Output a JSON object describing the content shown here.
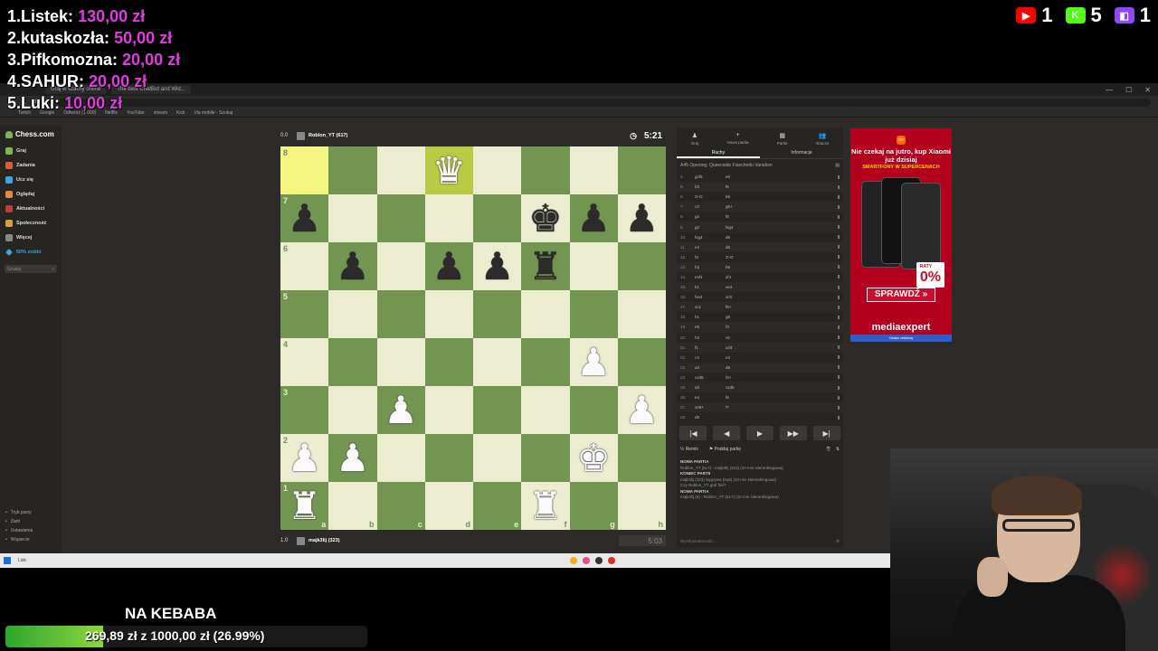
{
  "donations": [
    {
      "rank": "1.",
      "name": "Listek:",
      "amount": "130,00 zł"
    },
    {
      "rank": "2.",
      "name": "kutaskozła:",
      "amount": "50,00 zł"
    },
    {
      "rank": "3.",
      "name": "Pifkomozna:",
      "amount": "20,00 zł"
    },
    {
      "rank": "4.",
      "name": "SAHUR:",
      "amount": "20,00 zł"
    },
    {
      "rank": "5.",
      "name": "Luki:",
      "amount": "10,00 zł"
    }
  ],
  "counters": [
    {
      "platform": "youtube",
      "count": "1",
      "color": "#ff0000",
      "icon": "youtube-icon"
    },
    {
      "platform": "kick",
      "count": "5",
      "color": "#53fc18",
      "icon": "kick-icon"
    },
    {
      "platform": "twitch",
      "count": "1",
      "color": "#9146ff",
      "icon": "twitch-icon"
    }
  ],
  "browser": {
    "tabs": [
      "Graj w szachy online",
      "The best ChatBot and Wid..."
    ],
    "bookmarks": [
      "Twitch",
      "Google",
      "Odtwórz (1 000)",
      "Netflix",
      "YouTube",
      "stream",
      "Kick",
      "Via mobile - Szukaj"
    ]
  },
  "sidebar": {
    "logo": "Chess.com",
    "items": [
      {
        "label": "Graj",
        "color": "#81b64c"
      },
      {
        "label": "Zadania",
        "color": "#e05a3a"
      },
      {
        "label": "Ucz się",
        "color": "#3ba4d9"
      },
      {
        "label": "Oglądaj",
        "color": "#e08b3a"
      },
      {
        "label": "Aktualności",
        "color": "#c23b3b"
      },
      {
        "label": "Społeczność",
        "color": "#d9a03a"
      },
      {
        "label": "Więcej",
        "color": "#888888"
      }
    ],
    "promo": "50% zniżki",
    "search_placeholder": "Szukaj",
    "bottom": [
      "Tryb jasny",
      "Zwiń",
      "Ustawienia",
      "Wsparcie"
    ]
  },
  "top_player": {
    "score": "0.0",
    "name": "Roblon_YT (617)",
    "clock": "5:21"
  },
  "bottom_player": {
    "score": "1.0",
    "name": "majk3lij (323)",
    "clock": "5:03"
  },
  "board": {
    "files": [
      "a",
      "b",
      "c",
      "d",
      "e",
      "f",
      "g",
      "h"
    ],
    "ranks": [
      "8",
      "7",
      "6",
      "5",
      "4",
      "3",
      "2",
      "1"
    ],
    "highlights": [
      "a8",
      "d8"
    ],
    "pieces": {
      "d8": {
        "type": "queen",
        "color": "white",
        "glyph": "♛"
      },
      "a7": {
        "type": "pawn",
        "color": "black",
        "glyph": "♟"
      },
      "f7": {
        "type": "king",
        "color": "black",
        "glyph": "♚"
      },
      "g7": {
        "type": "pawn",
        "color": "black",
        "glyph": "♟"
      },
      "h7": {
        "type": "pawn",
        "color": "black",
        "glyph": "♟"
      },
      "b6": {
        "type": "pawn",
        "color": "black",
        "glyph": "♟"
      },
      "d6": {
        "type": "pawn",
        "color": "black",
        "glyph": "♟"
      },
      "e6": {
        "type": "pawn",
        "color": "black",
        "glyph": "♟"
      },
      "f6": {
        "type": "rook",
        "color": "black",
        "glyph": "♜"
      },
      "g4": {
        "type": "pawn",
        "color": "white",
        "glyph": "♟"
      },
      "c3": {
        "type": "pawn",
        "color": "white",
        "glyph": "♟"
      },
      "h3": {
        "type": "pawn",
        "color": "white",
        "glyph": "♟"
      },
      "a2": {
        "type": "pawn",
        "color": "white",
        "glyph": "♟"
      },
      "b2": {
        "type": "pawn",
        "color": "white",
        "glyph": "♟"
      },
      "g2": {
        "type": "king",
        "color": "white",
        "glyph": "♚"
      },
      "a1": {
        "type": "rook",
        "color": "white",
        "glyph": "♜"
      },
      "f1": {
        "type": "rook",
        "color": "white",
        "glyph": "♜"
      }
    }
  },
  "moves_panel": {
    "tabs": [
      {
        "label": "Graj",
        "icon": "♟"
      },
      {
        "label": "Nowa partia",
        "icon": "+"
      },
      {
        "label": "Partie",
        "icon": "▦"
      },
      {
        "label": "Gracze",
        "icon": "👥"
      }
    ],
    "subtabs": [
      "Ruchy",
      "Informacje"
    ],
    "opening": "A45 Opening: Queenside Fianchetto Variation",
    "moves": [
      {
        "n": "4.",
        "w": "gxf5",
        "b": "e6"
      },
      {
        "n": "5.",
        "w": "b3",
        "b": "f6"
      },
      {
        "n": "6.",
        "w": "O-O",
        "b": "b5"
      },
      {
        "n": "7.",
        "w": "c3",
        "b": "g5+"
      },
      {
        "n": "8.",
        "w": "g4",
        "b": "f5"
      },
      {
        "n": "9.",
        "w": "g2",
        "b": "fxg4"
      },
      {
        "n": "10.",
        "w": "fxg4",
        "b": "d6"
      },
      {
        "n": "11.",
        "w": "e4",
        "b": "d5"
      },
      {
        "n": "12.",
        "w": "f3",
        "b": "O-O"
      },
      {
        "n": "13.",
        "w": "h3",
        "b": "h6"
      },
      {
        "n": "14.",
        "w": "exf4",
        "b": "xf4"
      },
      {
        "n": "15.",
        "w": "b1",
        "b": "xe4"
      },
      {
        "n": "16.",
        "w": "fxe4",
        "b": "xc5"
      },
      {
        "n": "17.",
        "w": "xc1",
        "b": "f5+"
      },
      {
        "n": "18.",
        "w": "h1",
        "b": "g6"
      },
      {
        "n": "19.",
        "w": "e5",
        "b": "f3"
      },
      {
        "n": "20.",
        "w": "h3",
        "b": "c6"
      },
      {
        "n": "21.",
        "w": "f1",
        "b": "xd4"
      },
      {
        "n": "22.",
        "w": "c3",
        "b": "e2"
      },
      {
        "n": "23.",
        "w": "a3",
        "b": "d6"
      },
      {
        "n": "24.",
        "w": "cxd5",
        "b": "f4+"
      },
      {
        "n": "25.",
        "w": "d4",
        "b": "cxd6"
      },
      {
        "n": "26.",
        "w": "e4",
        "b": "f6"
      },
      {
        "n": "27.",
        "w": "xe8+",
        "b": "f7"
      },
      {
        "n": "28.",
        "w": "d8",
        "b": ""
      }
    ],
    "nav": [
      "|◀",
      "◀",
      "▶",
      "▶▶",
      "▶|"
    ],
    "remis": "Remis",
    "resign": "Poddaj partię",
    "chat": [
      {
        "head": "NOWA PARTIA",
        "text": "Roblon_YT (617) - majk3lij (323) (10 min Nierankingowa)"
      },
      {
        "head": "KONIEC PARTII",
        "text": "majk3lij (323) wygrywa (mat) (10 min Nierankingowa)"
      },
      {
        "head": "",
        "text": "Czy Roblon_YT graf fair?"
      },
      {
        "head": "NOWA PARTIA",
        "text": "majk3lij (5) - Roblon_YT (617) (10 min Nierankingowa)"
      }
    ],
    "chat_placeholder": "Wyślij wiadomość..."
  },
  "ad": {
    "brand_small": "mi",
    "headline": "Nie czekaj na jutro, kup Xiaomi już dzisiaj",
    "sub": "SMARTFONY W SUPERCENACH",
    "raty_small": "RATY",
    "raty": "0%",
    "button": "SPRAWDŹ »",
    "store": "mediaexpert",
    "footer": "Ustaw reklamę"
  },
  "taskbar": {
    "search": "Lisk"
  },
  "goal": {
    "title": "NA KEBABA",
    "text": "269,89 zł z 1000,00 zł (26.99%)",
    "progress": 0.2699
  }
}
